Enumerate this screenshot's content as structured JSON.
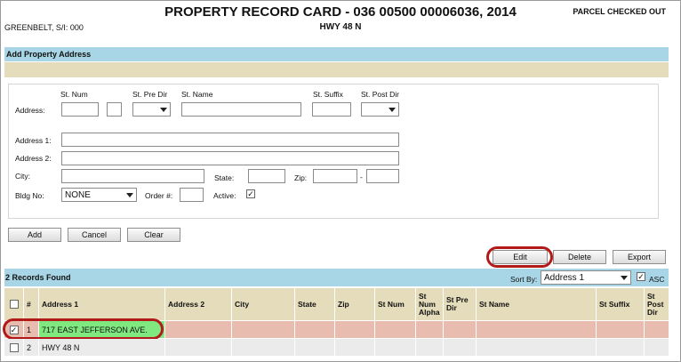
{
  "header": {
    "title": "PROPERTY RECORD CARD - 036 00500 00006036, 2014",
    "subtitle": "HWY 48 N",
    "left_info": "GREENBELT, S/I: 000",
    "right_info": "PARCEL CHECKED OUT"
  },
  "section": {
    "title": "Add Property Address"
  },
  "form": {
    "address_label": "Address:",
    "st_num_label": "St. Num",
    "st_pre_dir_label": "St. Pre Dir",
    "st_name_label": "St. Name",
    "st_suffix_label": "St. Suffix",
    "st_post_dir_label": "St. Post Dir",
    "address1_label": "Address 1:",
    "address2_label": "Address 2:",
    "city_label": "City:",
    "state_label": "State:",
    "zip_label": "Zip:",
    "zip_sep": "-",
    "bldg_label": "Bldg No:",
    "bldg_value": "NONE",
    "order_label": "Order #:",
    "active_label": "Active:",
    "active_checked": "✓"
  },
  "buttons": {
    "add": "Add",
    "cancel": "Cancel",
    "clear": "Clear",
    "edit": "Edit",
    "delete": "Delete",
    "export": "Export"
  },
  "results": {
    "count_text": "2 Records Found",
    "sort_label": "Sort By:",
    "sort_value": "Address 1",
    "asc_label": "ASC",
    "asc_checked": "✓"
  },
  "table": {
    "headers": [
      "#",
      "Address 1",
      "Address 2",
      "City",
      "State",
      "Zip",
      "St Num",
      "St Num Alpha",
      "St Pre Dir",
      "St Name",
      "St Suffix",
      "St Post Dir"
    ],
    "rows": [
      {
        "checked": "✓",
        "num": "1",
        "address1": "717 EAST JEFFERSON AVE."
      },
      {
        "checked": "",
        "num": "2",
        "address1": "HWY 48 N"
      }
    ]
  },
  "colors": {
    "header_band": "#a9d6e6",
    "tan_band": "#e4dcbb",
    "selected_row": "#e8bdb0",
    "highlight": "#7fe87f",
    "annotation": "#b21a1a"
  }
}
